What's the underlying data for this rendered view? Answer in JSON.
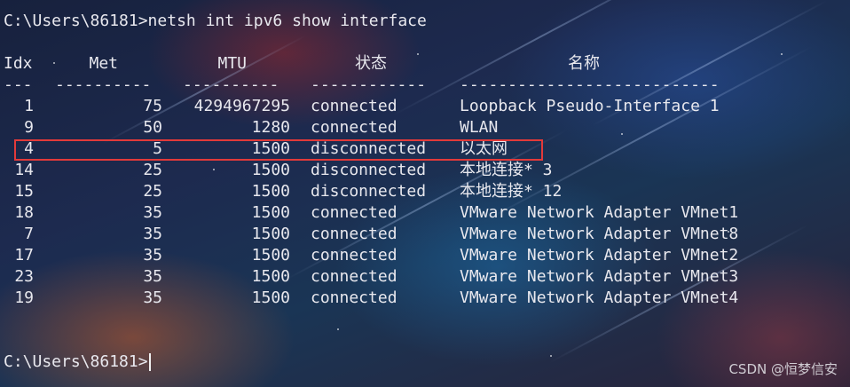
{
  "terminal": {
    "command_line": "C:\\Users\\86181>netsh int ipv6 show interface",
    "headers": {
      "idx": "Idx",
      "met": "Met",
      "mtu": "MTU",
      "state": "状态",
      "name": "名称"
    },
    "separators": {
      "idx": "---",
      "met": "----------",
      "mtu": "----------",
      "state": "------------",
      "name": "---------------------------"
    },
    "rows": [
      {
        "idx": "1",
        "met": "75",
        "mtu": "4294967295",
        "state": "connected",
        "name": "Loopback Pseudo-Interface 1"
      },
      {
        "idx": "9",
        "met": "50",
        "mtu": "1280",
        "state": "connected",
        "name": "WLAN"
      },
      {
        "idx": "4",
        "met": "5",
        "mtu": "1500",
        "state": "disconnected",
        "name": "以太网"
      },
      {
        "idx": "14",
        "met": "25",
        "mtu": "1500",
        "state": "disconnected",
        "name": "本地连接* 3"
      },
      {
        "idx": "15",
        "met": "25",
        "mtu": "1500",
        "state": "disconnected",
        "name": "本地连接* 12"
      },
      {
        "idx": "18",
        "met": "35",
        "mtu": "1500",
        "state": "connected",
        "name": "VMware Network Adapter VMnet1"
      },
      {
        "idx": "7",
        "met": "35",
        "mtu": "1500",
        "state": "connected",
        "name": "VMware Network Adapter VMnet8"
      },
      {
        "idx": "17",
        "met": "35",
        "mtu": "1500",
        "state": "connected",
        "name": "VMware Network Adapter VMnet2"
      },
      {
        "idx": "23",
        "met": "35",
        "mtu": "1500",
        "state": "connected",
        "name": "VMware Network Adapter VMnet3"
      },
      {
        "idx": "19",
        "met": "35",
        "mtu": "1500",
        "state": "connected",
        "name": "VMware Network Adapter VMnet4"
      }
    ],
    "prompt": "C:\\Users\\86181>",
    "highlight_color": "#e23a3a"
  },
  "watermark": "CSDN @恒梦信安"
}
